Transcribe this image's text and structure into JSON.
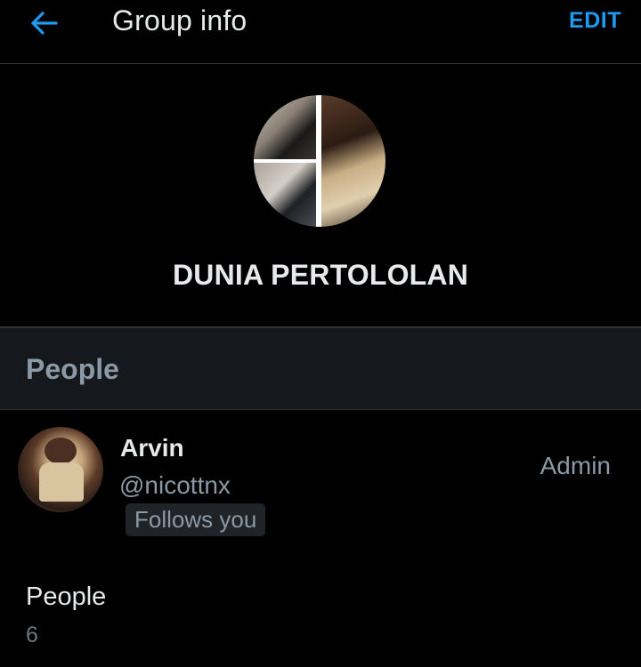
{
  "header": {
    "back_icon": "arrow-left-icon",
    "title": "Group info",
    "edit_label": "EDIT"
  },
  "group": {
    "avatar_icon": "group-avatar-collage",
    "name": "DUNIA PERTOLOLAN"
  },
  "people_section": {
    "header_label": "People",
    "members": [
      {
        "name": "Arvin",
        "handle": "@nicottnx",
        "badge": "Follows you",
        "role": "Admin"
      }
    ]
  },
  "people_count": {
    "label": "People",
    "value": "6"
  },
  "colors": {
    "background": "#000000",
    "accent": "#1d9bf0",
    "primary_text": "#e7e9ea",
    "secondary_text": "#8b98a5",
    "section_band": "#15181c",
    "divider": "#2f3336"
  }
}
